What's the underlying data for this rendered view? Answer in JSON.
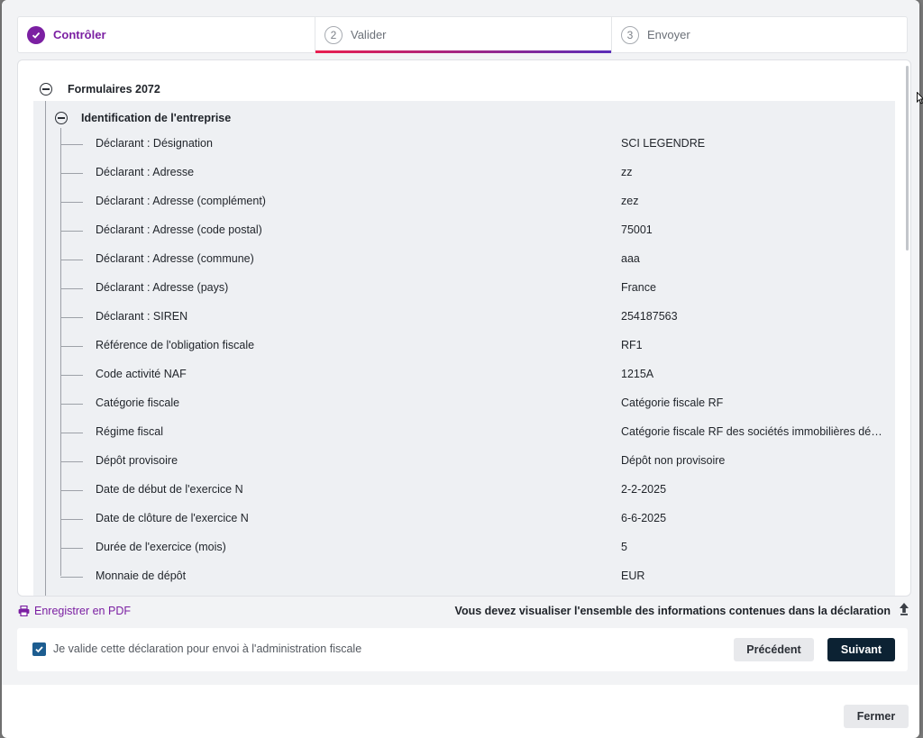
{
  "stepper": {
    "steps": [
      {
        "label": "Contrôler",
        "number": "",
        "state": "done"
      },
      {
        "label": "Valider",
        "number": "2",
        "state": "active"
      },
      {
        "label": "Envoyer",
        "number": "3",
        "state": "todo"
      }
    ]
  },
  "tree": {
    "root_label": "Formulaires 2072",
    "section_label": "Identification de l'entreprise",
    "rows": [
      {
        "label": "Déclarant : Désignation",
        "value": "SCI LEGENDRE"
      },
      {
        "label": "Déclarant : Adresse",
        "value": "zz"
      },
      {
        "label": "Déclarant : Adresse (complément)",
        "value": "zez"
      },
      {
        "label": "Déclarant : Adresse (code postal)",
        "value": "75001"
      },
      {
        "label": "Déclarant : Adresse (commune)",
        "value": "aaa"
      },
      {
        "label": "Déclarant : Adresse (pays)",
        "value": "France"
      },
      {
        "label": "Déclarant : SIREN",
        "value": "254187563"
      },
      {
        "label": "Référence de l'obligation fiscale",
        "value": "RF1"
      },
      {
        "label": "Code activité NAF",
        "value": "1215A"
      },
      {
        "label": "Catégorie fiscale",
        "value": "Catégorie fiscale RF"
      },
      {
        "label": "Régime fiscal",
        "value": "Catégorie fiscale RF des sociétés immobilières dépo…"
      },
      {
        "label": "Dépôt provisoire",
        "value": "Dépôt non provisoire"
      },
      {
        "label": "Date de début de l'exercice N",
        "value": "2-2-2025"
      },
      {
        "label": "Date de clôture de l'exercice N",
        "value": "6-6-2025"
      },
      {
        "label": "Durée de l'exercice (mois)",
        "value": "5"
      },
      {
        "label": "Monnaie de dépôt",
        "value": "EUR"
      }
    ]
  },
  "footer": {
    "pdf_label": "Enregistrer en PDF",
    "notice": "Vous devez visualiser l'ensemble des informations contenues dans la déclaration"
  },
  "validation": {
    "checkbox_label": "Je valide cette déclaration pour envoi à l'administration fiscale",
    "checked": true,
    "prev_label": "Précédent",
    "next_label": "Suivant"
  },
  "close_label": "Fermer",
  "colors": {
    "accent": "#7b1fa2",
    "primary_button": "#0c2233",
    "checkbox": "#1d5d90"
  }
}
